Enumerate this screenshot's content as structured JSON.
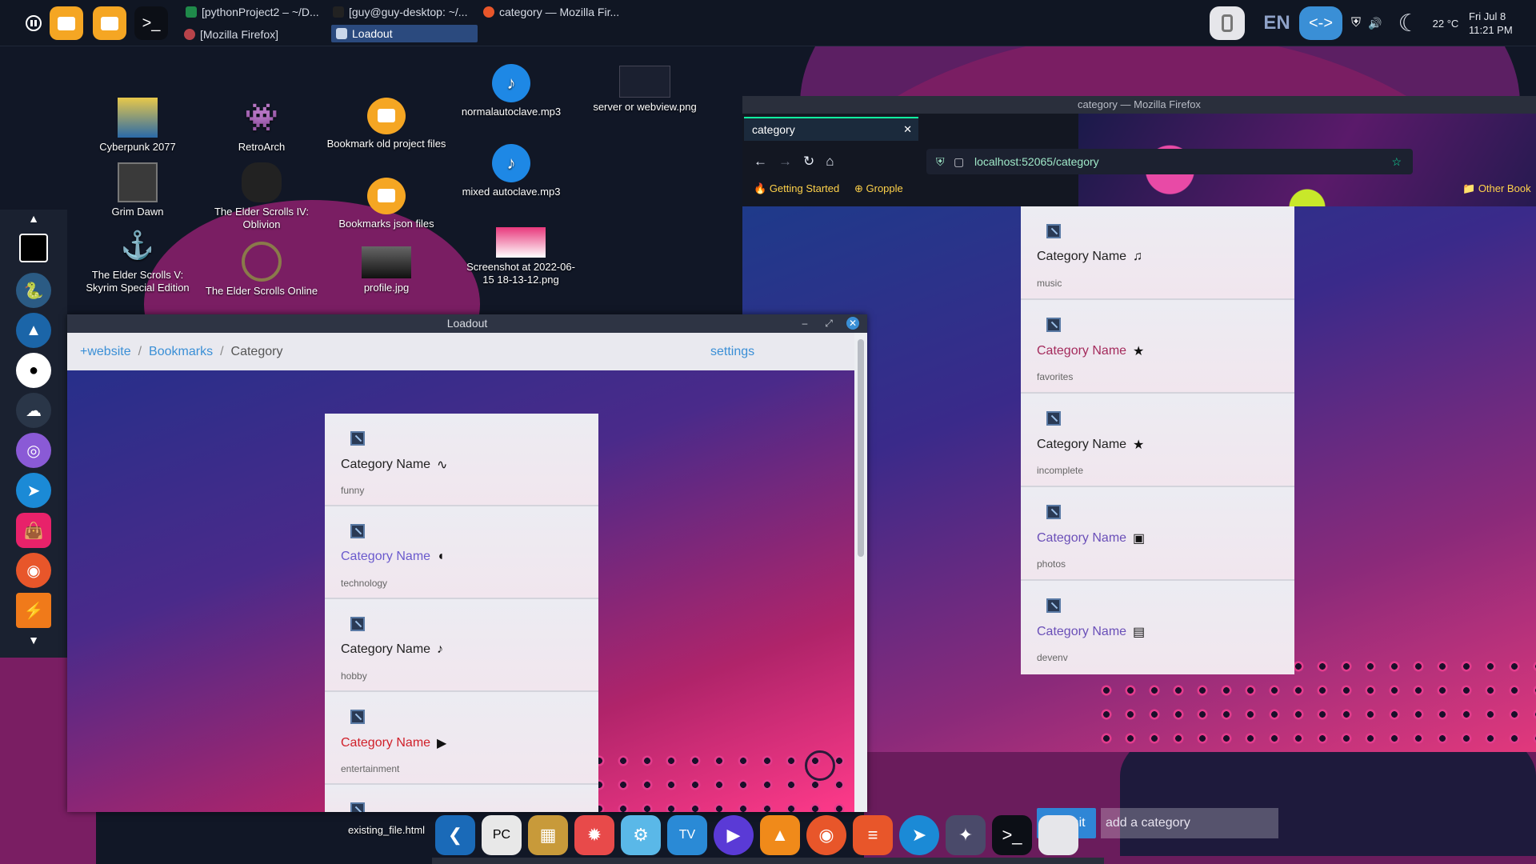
{
  "taskbar": {
    "tasks": [
      {
        "label": "[pythonProject2 – ~/D..."
      },
      {
        "label": "[guy@guy-desktop: ~/..."
      },
      {
        "label": "category — Mozilla Fir..."
      },
      {
        "label": "[Mozilla Firefox]"
      },
      {
        "label": "Loadout"
      }
    ],
    "language": "EN",
    "temperature": "22 °C",
    "date": "Fri Jul 8",
    "time": "11:21 PM"
  },
  "desktop": {
    "icons": [
      {
        "label": "Cyberpunk 2077"
      },
      {
        "label": "RetroArch"
      },
      {
        "label": "Bookmark old project files"
      },
      {
        "label": "normalautoclave.mp3"
      },
      {
        "label": "server or webview.png"
      },
      {
        "label": "Grim Dawn"
      },
      {
        "label": "The Elder Scrolls IV: Oblivion"
      },
      {
        "label": "Bookmarks json files"
      },
      {
        "label": "mixed autoclave.mp3"
      },
      {
        "label": "The Elder Scrolls V: Skyrim Special Edition"
      },
      {
        "label": "The Elder Scrolls Online"
      },
      {
        "label": "profile.jpg"
      },
      {
        "label": "Screenshot at 2022-06-15 18-13-12.png"
      },
      {
        "label": "existing_file.html"
      }
    ]
  },
  "loadout": {
    "title": "Loadout",
    "breadcrumb": {
      "home": "+website",
      "bookmarks": "Bookmarks",
      "current": "Category"
    },
    "settings": "settings",
    "categories": [
      {
        "name": "Category Name",
        "sub": "funny",
        "icon": "mustache-icon"
      },
      {
        "name": "Category Name",
        "sub": "technology",
        "icon": "mouse-icon"
      },
      {
        "name": "Category Name",
        "sub": "hobby",
        "icon": "guitar-icon"
      },
      {
        "name": "Category Name",
        "sub": "entertainment",
        "icon": "tv-icon"
      }
    ]
  },
  "firefox": {
    "title": "category — Mozilla Firefox",
    "tab_title": "category",
    "url": "localhost:52065/category",
    "bookmarks": [
      "Getting Started",
      "Gropple",
      "Other Book"
    ],
    "categories": [
      {
        "name": "Category Name",
        "sub": "music",
        "icon": "music-note-icon"
      },
      {
        "name": "Category Name",
        "sub": "favorites",
        "icon": "star-icon"
      },
      {
        "name": "Category Name",
        "sub": "incomplete",
        "icon": "star-icon"
      },
      {
        "name": "Category Name",
        "sub": "photos",
        "icon": "add-photo-icon"
      },
      {
        "name": "Category Name",
        "sub": "devenv",
        "icon": "html5-icon"
      }
    ],
    "submit_label": "submit",
    "add_placeholder": "add a category"
  }
}
